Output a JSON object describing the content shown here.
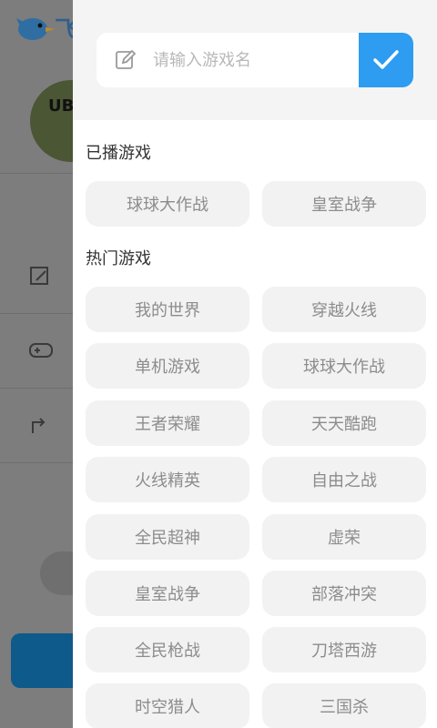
{
  "background": {
    "logo_text": "飞",
    "avatar_text": "UBE"
  },
  "search": {
    "placeholder": "请输入游戏名"
  },
  "recent": {
    "title": "已播游戏",
    "items": [
      "球球大作战",
      "皇室战争"
    ]
  },
  "hot": {
    "title": "热门游戏",
    "items": [
      "我的世界",
      "穿越火线",
      "单机游戏",
      "球球大作战",
      "王者荣耀",
      "天天酷跑",
      "火线精英",
      "自由之战",
      "全民超神",
      "虚荣",
      "皇室战争",
      "部落冲突",
      "全民枪战",
      "刀塔西游",
      "时空猎人",
      "三国杀"
    ]
  },
  "colors": {
    "accent": "#2d9cf1"
  }
}
